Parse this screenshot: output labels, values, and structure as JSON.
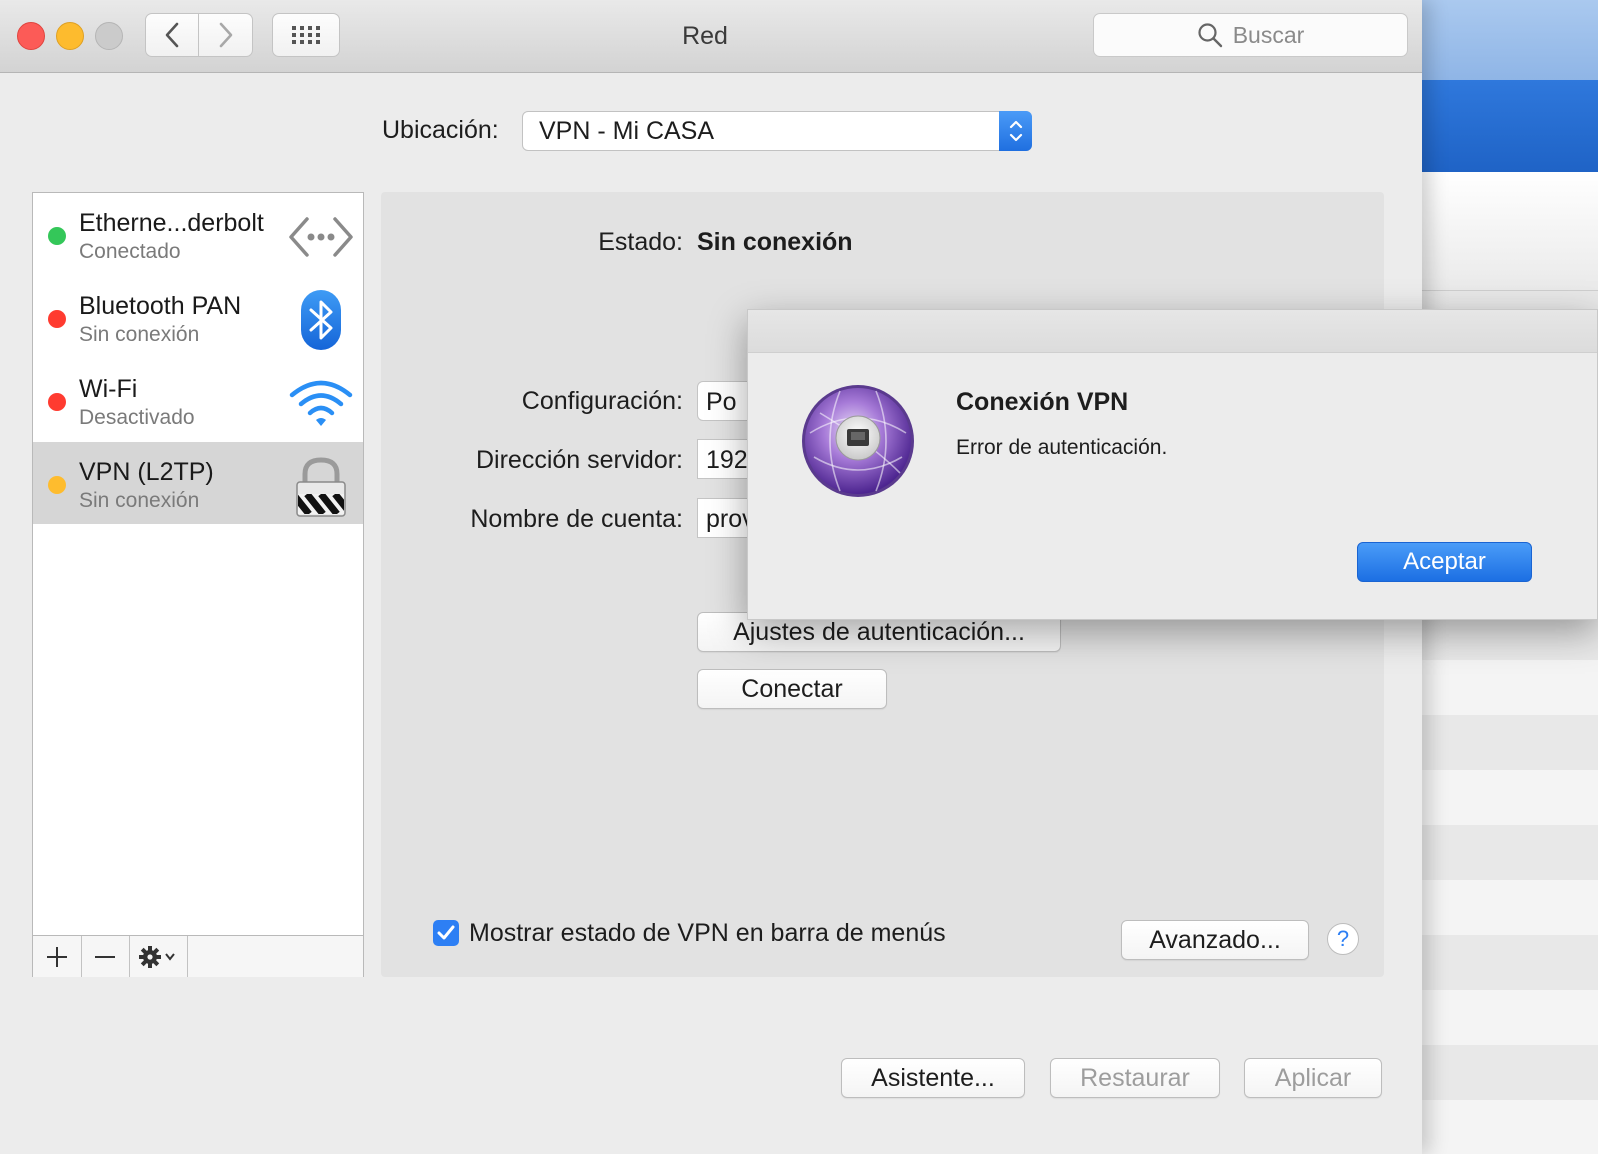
{
  "window": {
    "title": "Red",
    "search_placeholder": "Buscar"
  },
  "location": {
    "label": "Ubicación:",
    "value": "VPN - Mi CASA"
  },
  "services": [
    {
      "name": "Etherne...derbolt",
      "status": "Conectado",
      "status_color": "#34c759",
      "icon": "ethernet-icon"
    },
    {
      "name": "Bluetooth PAN",
      "status": "Sin conexión",
      "status_color": "#ff3b30",
      "icon": "bluetooth-icon"
    },
    {
      "name": "Wi-Fi",
      "status": "Desactivado",
      "status_color": "#ff3b30",
      "icon": "wifi-icon"
    },
    {
      "name": "VPN (L2TP)",
      "status": "Sin conexión",
      "status_color": "#febc2e",
      "icon": "vpn-lock-icon",
      "selected": true
    }
  ],
  "sidebar_buttons": {
    "add": "+",
    "remove": "—",
    "gear": "gear-icon"
  },
  "detail": {
    "status_label": "Estado:",
    "status_value": "Sin conexión",
    "config_label": "Configuración:",
    "config_value": "Po",
    "server_label": "Dirección servidor:",
    "server_value": "192",
    "account_label": "Nombre de cuenta:",
    "account_value": "prov",
    "auth_button": "Ajustes de autenticación...",
    "connect_button": "Conectar",
    "show_status_label": "Mostrar estado de VPN en barra de menús",
    "show_status_checked": true,
    "advanced_button": "Avanzado...",
    "help": "?"
  },
  "footer": {
    "assistant": "Asistente...",
    "revert": "Restaurar",
    "apply": "Aplicar"
  },
  "alert": {
    "title": "Conexión VPN",
    "message": "Error de autenticación.",
    "ok_button": "Aceptar"
  },
  "colors": {
    "accent": "#2d7ff4"
  }
}
